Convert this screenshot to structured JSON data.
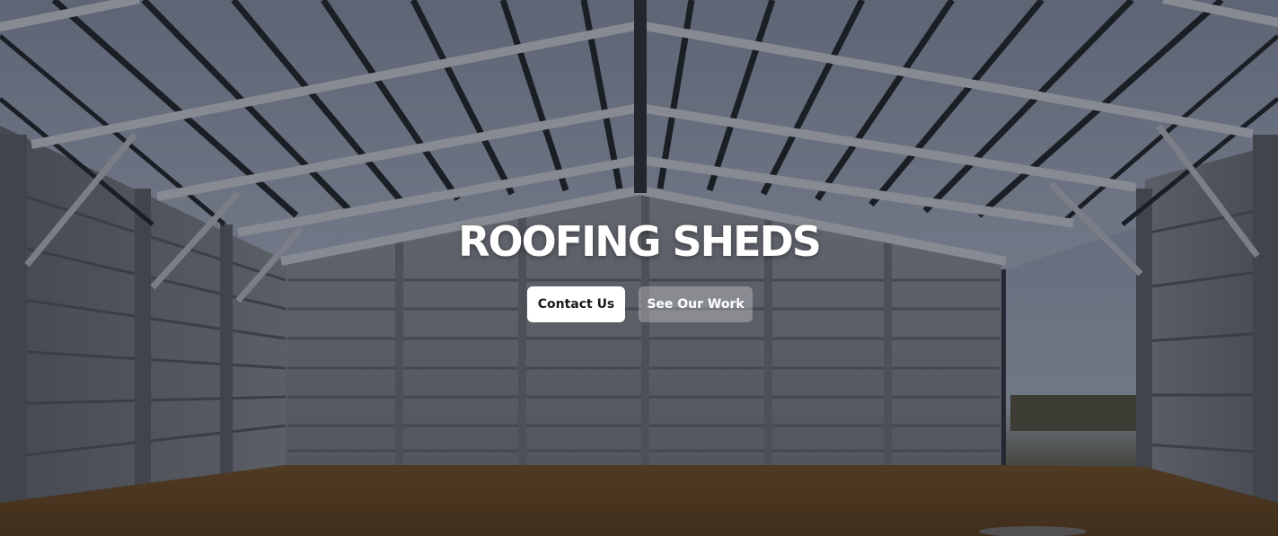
{
  "hero": {
    "title": "ROOFING SHEDS",
    "buttons": {
      "contact_label": "Contact Us",
      "work_label": "See Our Work"
    }
  },
  "colors": {
    "primary_button_bg": "#ffffff",
    "primary_button_text": "#1a1a1a",
    "secondary_button_text": "#ffffff",
    "title_text": "#ffffff"
  }
}
